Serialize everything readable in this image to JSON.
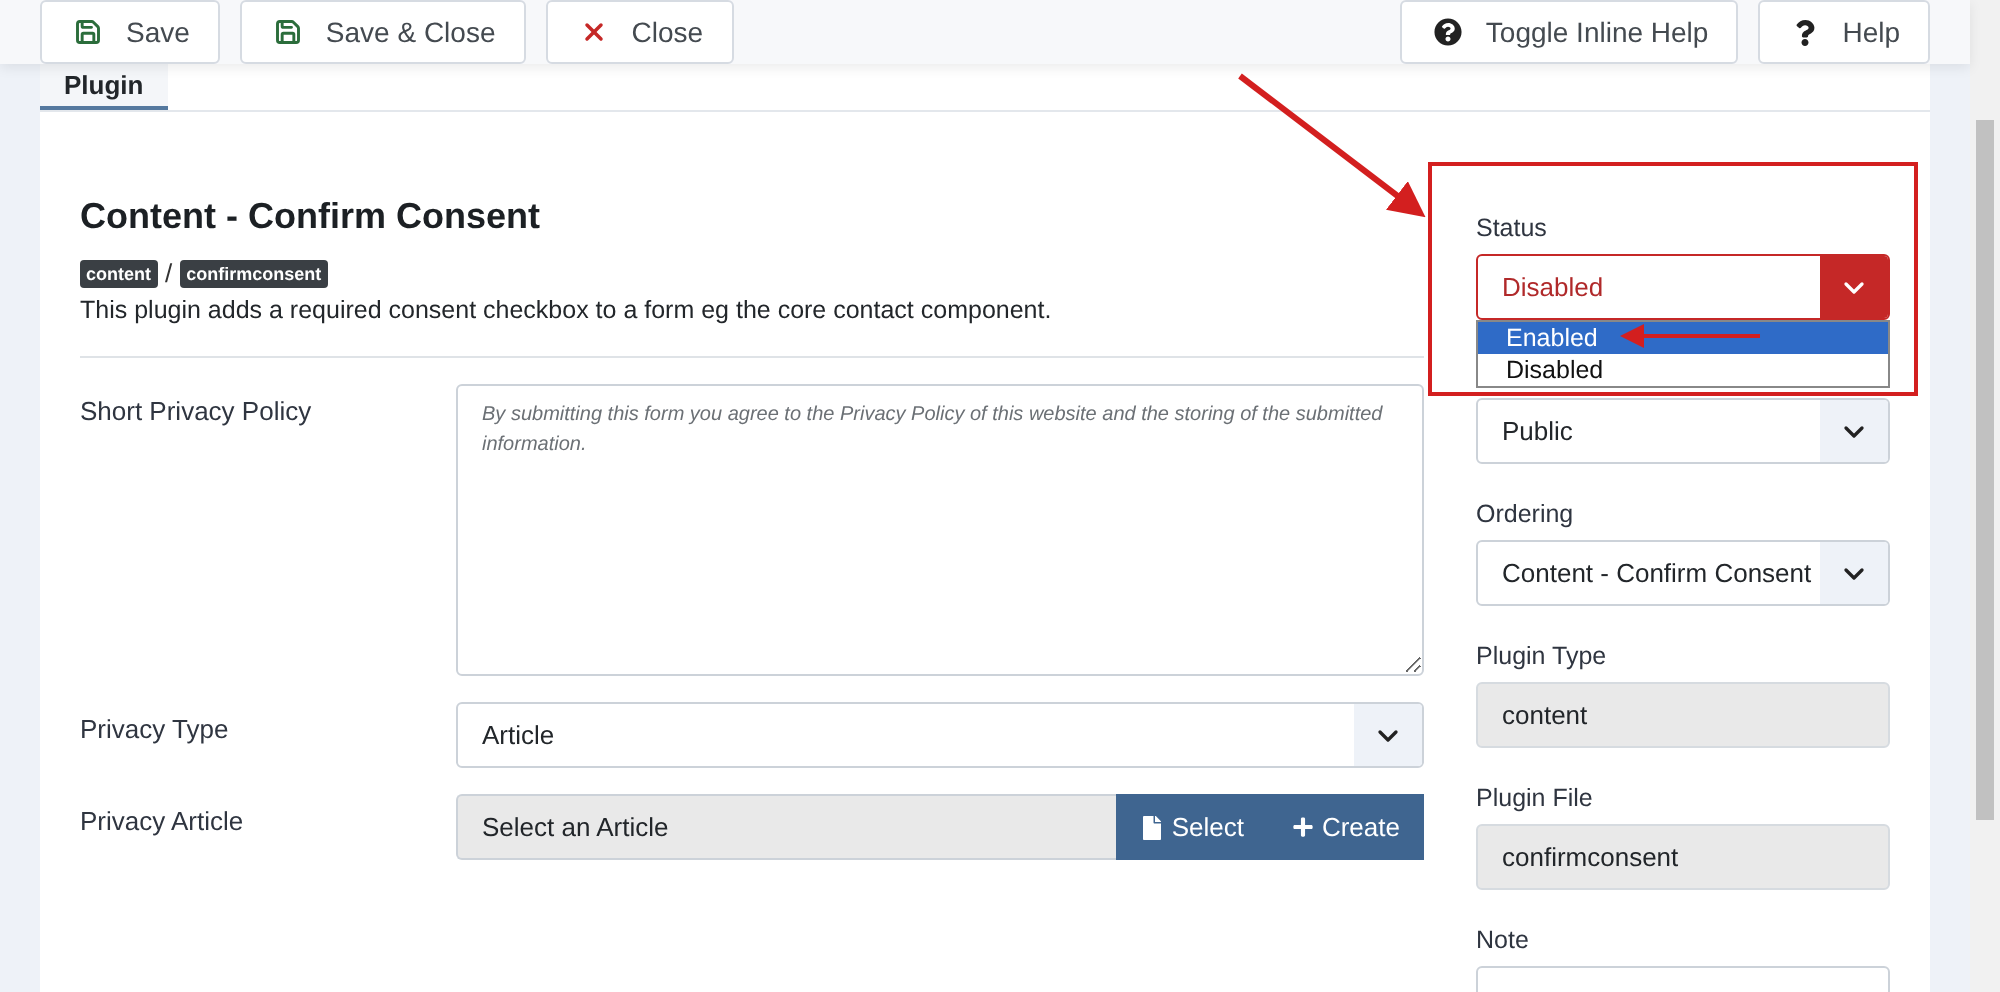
{
  "toolbar": {
    "left_buttons": [
      {
        "label": "Save"
      },
      {
        "label": "Save & Close"
      },
      {
        "label": "Close"
      }
    ],
    "right_buttons": [
      {
        "label": "Toggle Inline Help"
      },
      {
        "label": "Help"
      }
    ]
  },
  "tabs": [
    {
      "label": "Plugin",
      "selected": true
    }
  ],
  "plugin": {
    "title": "Content - Confirm Consent",
    "tags": [
      "content",
      "confirmconsent"
    ],
    "tag_separator": "/",
    "description": "This plugin adds a required consent checkbox to a form eg the core contact component."
  },
  "form": [
    {
      "kind": "textarea",
      "label": "Short Privacy Policy",
      "placeholder": "By submitting this form you agree to the Privacy Policy of this website and the storing of the submitted information."
    },
    {
      "kind": "select",
      "label": "Privacy Type",
      "value": "Article"
    },
    {
      "kind": "picker",
      "label": "Privacy Article",
      "value": "Select an Article",
      "buttons": [
        {
          "label": "Select"
        },
        {
          "label": "Create"
        }
      ]
    }
  ],
  "sidebar": [
    {
      "kind": "status",
      "label": "Status",
      "value": "Disabled",
      "expanded": true,
      "options": [
        {
          "label": "Enabled",
          "highlighted": true
        },
        {
          "label": "Disabled",
          "highlighted": false
        }
      ]
    },
    {
      "kind": "select",
      "value": "Public"
    },
    {
      "kind": "select",
      "label": "Ordering",
      "value": "Content - Confirm Consent"
    },
    {
      "kind": "readonly",
      "label": "Plugin Type",
      "value": "content"
    },
    {
      "kind": "readonly",
      "label": "Plugin File",
      "value": "confirmconsent"
    },
    {
      "kind": "text",
      "label": "Note"
    }
  ]
}
